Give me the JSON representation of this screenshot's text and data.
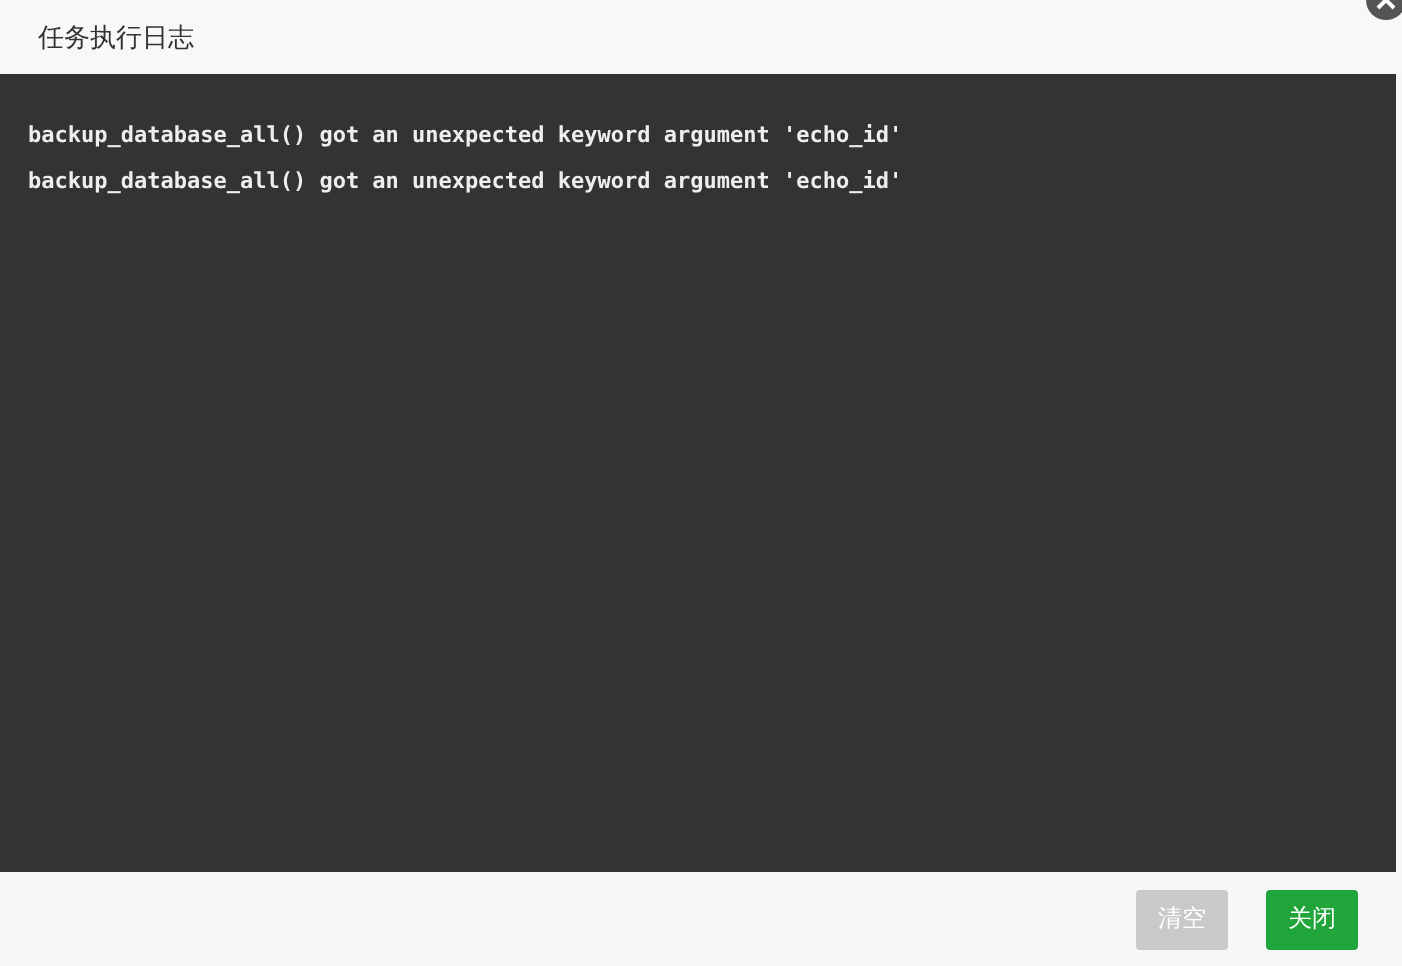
{
  "window": {
    "title": "任务执行日志"
  },
  "log": {
    "lines": [
      "backup_database_all() got an unexpected keyword argument 'echo_id'",
      "backup_database_all() got an unexpected keyword argument 'echo_id'"
    ]
  },
  "buttons": [
    {
      "label": "清空",
      "kind": "secondary",
      "disabled": true
    },
    {
      "label": "关闭",
      "kind": "primary",
      "disabled": false
    }
  ]
}
